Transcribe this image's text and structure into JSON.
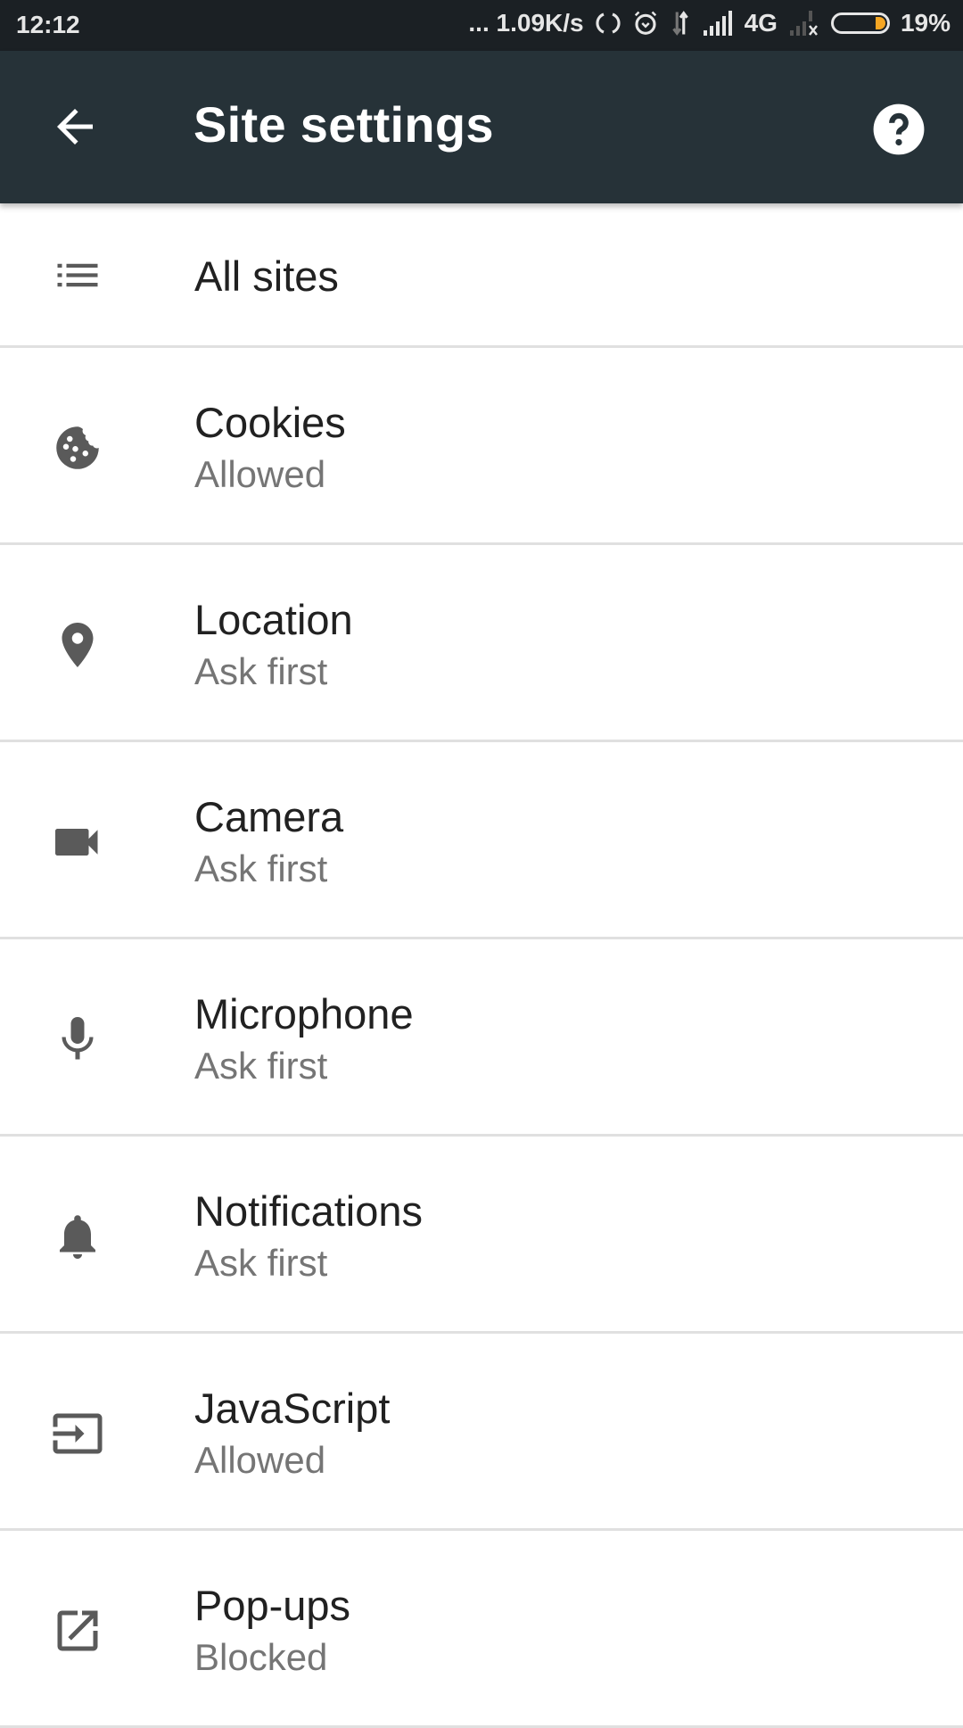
{
  "status_bar": {
    "time": "12:12",
    "network_speed": "... 1.09K/s",
    "network_type": "4G",
    "battery_percent": "19%",
    "battery_level": 0.19,
    "battery_color": "#f5a623"
  },
  "toolbar": {
    "title": "Site settings",
    "back_icon": "arrow-back-icon",
    "help_icon": "help-icon"
  },
  "items": [
    {
      "title": "All sites",
      "icon": "list-icon"
    },
    {
      "title": "Cookies",
      "subtitle": "Allowed",
      "icon": "cookie-icon"
    },
    {
      "title": "Location",
      "subtitle": "Ask first",
      "icon": "location-pin-icon"
    },
    {
      "title": "Camera",
      "subtitle": "Ask first",
      "icon": "videocam-icon"
    },
    {
      "title": "Microphone",
      "subtitle": "Ask first",
      "icon": "microphone-icon"
    },
    {
      "title": "Notifications",
      "subtitle": "Ask first",
      "icon": "bell-icon"
    },
    {
      "title": "JavaScript",
      "subtitle": "Allowed",
      "icon": "input-icon"
    },
    {
      "title": "Pop-ups",
      "subtitle": "Blocked",
      "icon": "open-in-new-icon"
    }
  ]
}
